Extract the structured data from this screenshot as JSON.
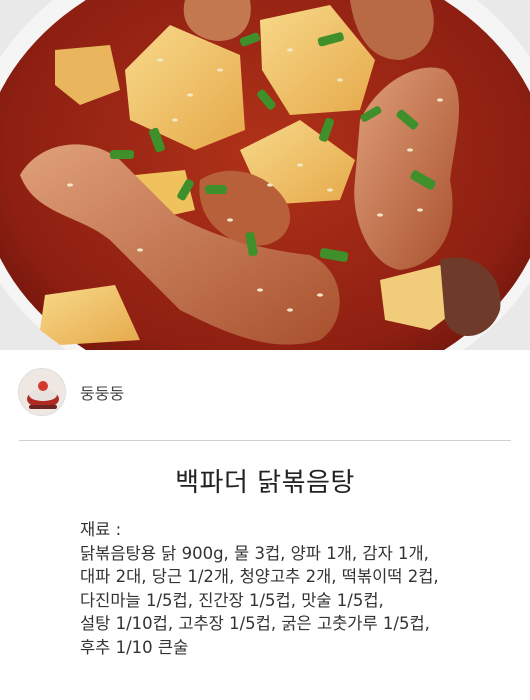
{
  "author": {
    "name": "둥둥둥",
    "avatar_icon": "avatar-food-photo"
  },
  "recipe": {
    "title": "백파더 닭볶음탕",
    "ingredients_heading": "재료 :",
    "ingredient_lines": [
      "닭볶음탕용 닭 900g, 물 3컵, 양파 1개, 감자 1개,",
      "대파 2대, 당근 1/2개, 청양고추 2개, 떡볶이떡 2컵,",
      "다진마늘 1/5컵, 진간장 1/5컵, 맛술 1/5컵,",
      "설탕 1/10컵, 고추장 1/5컵, 굵은 고춧가루 1/5컵,",
      "후추 1/10 큰술"
    ]
  },
  "colors": {
    "sauce": "#8e1f12",
    "potato": "#f2c76b",
    "green_onion": "#3f8f2a",
    "chicken": "#c9744a",
    "bowl": "#f3f3f3"
  }
}
